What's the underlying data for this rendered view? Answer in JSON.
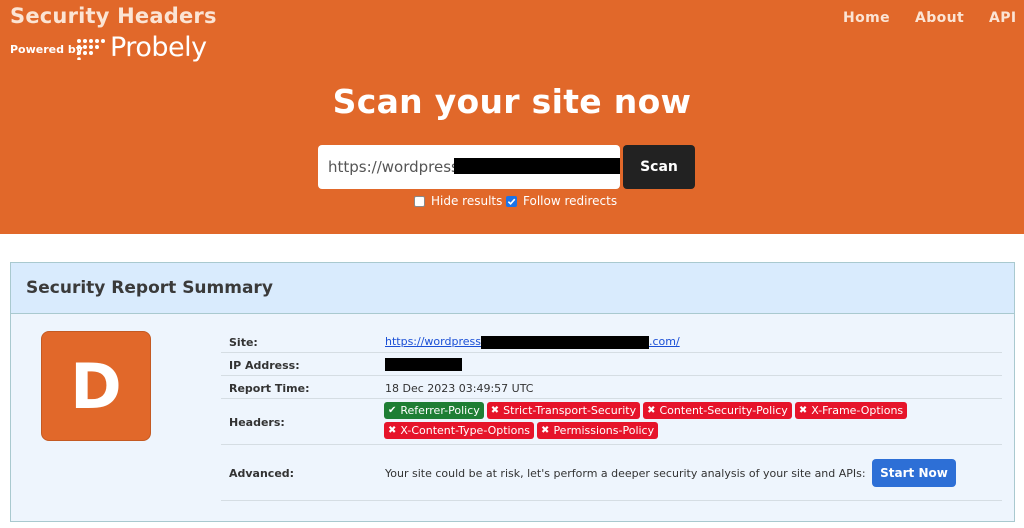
{
  "brand": {
    "title": "Security Headers",
    "powered_by": "Powered by",
    "partner": "Probely"
  },
  "nav": {
    "home": "Home",
    "about": "About",
    "api": "API"
  },
  "hero": {
    "title": "Scan your site now",
    "url_value": "https://wordpress",
    "scan_label": "Scan",
    "hide_results_label": "Hide results",
    "hide_results_checked": false,
    "follow_redirects_label": "Follow redirects",
    "follow_redirects_checked": true
  },
  "report": {
    "title": "Security Report Summary",
    "grade": "D",
    "grade_color": "#e1682a",
    "site_label": "Site:",
    "site_prefix": "https://wordpress",
    "site_suffix": ".com/",
    "ip_label": "IP Address:",
    "time_label": "Report Time:",
    "time_value": "18 Dec 2023 03:49:57 UTC",
    "headers_label": "Headers:",
    "headers": [
      {
        "name": "Referrer-Policy",
        "status": "pass"
      },
      {
        "name": "Strict-Transport-Security",
        "status": "fail"
      },
      {
        "name": "Content-Security-Policy",
        "status": "fail"
      },
      {
        "name": "X-Frame-Options",
        "status": "fail"
      },
      {
        "name": "X-Content-Type-Options",
        "status": "fail"
      },
      {
        "name": "Permissions-Policy",
        "status": "fail"
      }
    ],
    "advanced_label": "Advanced:",
    "advanced_text": "Your site could be at risk, let's perform a deeper security analysis of your site and APIs:",
    "start_label": "Start Now"
  },
  "colors": {
    "accent": "#e1682a",
    "pass": "#1e7e34",
    "fail": "#e6142a",
    "button_blue": "#2d6fd6"
  }
}
